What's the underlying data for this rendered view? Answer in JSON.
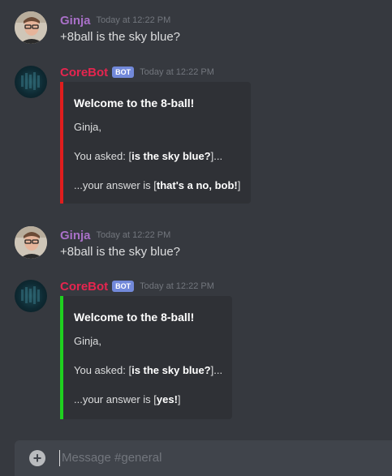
{
  "messages": [
    {
      "author": "Ginja",
      "timestamp": "Today at 12:22 PM",
      "text": "+8ball is the sky blue?"
    },
    {
      "author": "CoreBot",
      "bot_tag": "BOT",
      "timestamp": "Today at 12:22 PM",
      "embed": {
        "color": "#e01d1d",
        "title": "Welcome to the 8-ball!",
        "greeting": "Ginja,",
        "asked_prefix": "You asked: [",
        "question": "is the sky blue?",
        "asked_suffix": "]...",
        "answer_prefix": "...your answer is [",
        "answer": "that's a no, bob!",
        "answer_suffix": "]"
      }
    },
    {
      "author": "Ginja",
      "timestamp": "Today at 12:22 PM",
      "text": "+8ball is the sky blue?"
    },
    {
      "author": "CoreBot",
      "bot_tag": "BOT",
      "timestamp": "Today at 12:22 PM",
      "embed": {
        "color": "#1fd11f",
        "title": "Welcome to the 8-ball!",
        "greeting": "Ginja,",
        "asked_prefix": "You asked: [",
        "question": "is the sky blue?",
        "asked_suffix": "]...",
        "answer_prefix": "...your answer is [",
        "answer": "yes!",
        "answer_suffix": "]"
      }
    }
  ],
  "input": {
    "placeholder": "Message #general",
    "icon": "plus-circle-icon"
  },
  "colors": {
    "background": "#36393f",
    "user_name": "#a970c8",
    "bot_name": "#e6254f",
    "bot_tag": "#7289da",
    "embed_bg": "#2f3136"
  }
}
